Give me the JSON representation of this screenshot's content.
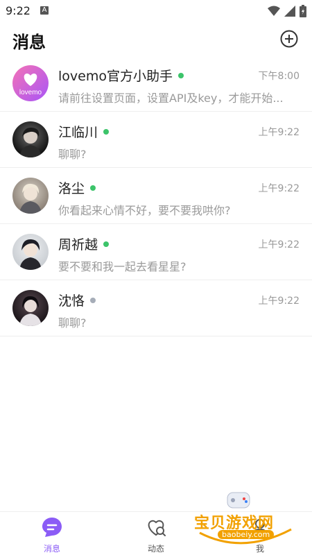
{
  "status_bar": {
    "time": "9:22",
    "notification_letter": "A"
  },
  "header": {
    "title": "消息"
  },
  "chats": [
    {
      "name": "lovemo官方小助手",
      "time": "下午8:00",
      "preview": "请前往设置页面，设置API及key，才能开始...",
      "status_color": "#3cc46a",
      "avatar_text": "lovemo"
    },
    {
      "name": "江临川",
      "time": "上午9:22",
      "preview": "聊聊?",
      "status_color": "#3cc46a"
    },
    {
      "name": "洛尘",
      "time": "上午9:22",
      "preview": "你看起来心情不好，要不要我哄你?",
      "status_color": "#3cc46a"
    },
    {
      "name": "周祈越",
      "time": "上午9:22",
      "preview": "要不要和我一起去看星星?",
      "status_color": "#3cc46a"
    },
    {
      "name": "沈恪",
      "time": "上午9:22",
      "preview": "聊聊?",
      "status_color": "#a6adb8"
    }
  ],
  "bottom_nav": [
    {
      "label": "消息",
      "icon": "chat-bubble-icon",
      "active": true
    },
    {
      "label": "动态",
      "icon": "heart-search-icon",
      "active": false
    },
    {
      "label": "我",
      "icon": "person-icon",
      "active": false
    }
  ],
  "watermark": {
    "text": "宝贝游戏网",
    "url": "baobeiy.com"
  },
  "colors": {
    "accent": "#8b5cf6",
    "online": "#3cc46a",
    "offline": "#a6adb8"
  }
}
